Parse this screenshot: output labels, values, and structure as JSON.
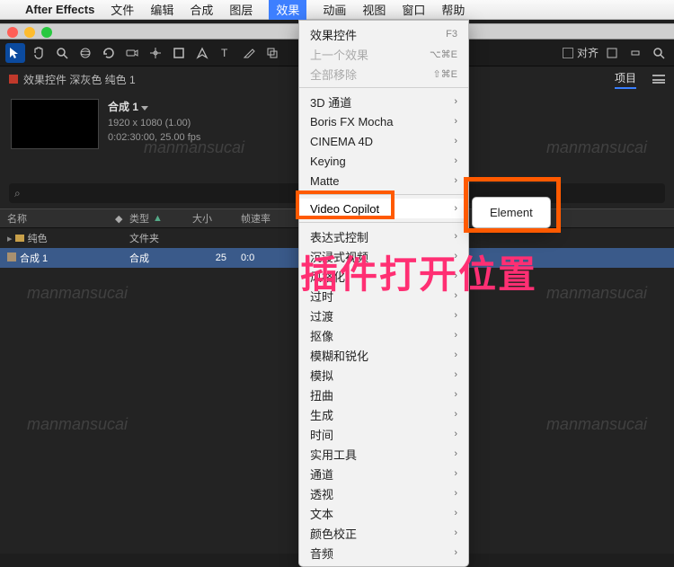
{
  "menubar": {
    "app": "After Effects",
    "items": [
      "文件",
      "编辑",
      "合成",
      "图层",
      "效果",
      "动画",
      "视图",
      "窗口",
      "帮助"
    ],
    "active_index": 4
  },
  "toolbar": {
    "snap_label": "对齐"
  },
  "panel": {
    "effect_controls_label": "效果控件 深灰色 纯色 1",
    "project_tab": "项目"
  },
  "comp": {
    "name": "合成 1",
    "dims": "1920 x 1080 (1.00)",
    "duration": "0:02:30:00, 25.00 fps"
  },
  "search": {
    "placeholder": ""
  },
  "project_header": {
    "name": "名称",
    "type": "类型",
    "size": "大小",
    "fps": "帧速率"
  },
  "project_rows": [
    {
      "name": "纯色",
      "type": "文件夹",
      "size": "",
      "fps": ""
    },
    {
      "name": "合成 1",
      "type": "合成",
      "size": "25",
      "fps": "0:0"
    }
  ],
  "dropdown": {
    "top": [
      {
        "label": "效果控件",
        "shortcut": "F3"
      },
      {
        "label": "上一个效果",
        "shortcut": "⌥⌘E",
        "disabled": true
      },
      {
        "label": "全部移除",
        "shortcut": "⇧⌘E",
        "disabled": true
      }
    ],
    "groups": [
      "3D 通道",
      "Boris FX Mocha",
      "CINEMA 4D",
      "Keying",
      "Matte",
      "Video Copilot",
      "表达式控制",
      "沉浸式视频",
      "风格化",
      "过时",
      "过渡",
      "抠像",
      "模糊和锐化",
      "模拟",
      "扭曲",
      "生成",
      "时间",
      "实用工具",
      "通道",
      "透视",
      "文本",
      "颜色校正",
      "音频"
    ],
    "highlight_index": 5
  },
  "submenu": {
    "item": "Element"
  },
  "annotation": "插件打开位置",
  "watermark": "manmansucai"
}
